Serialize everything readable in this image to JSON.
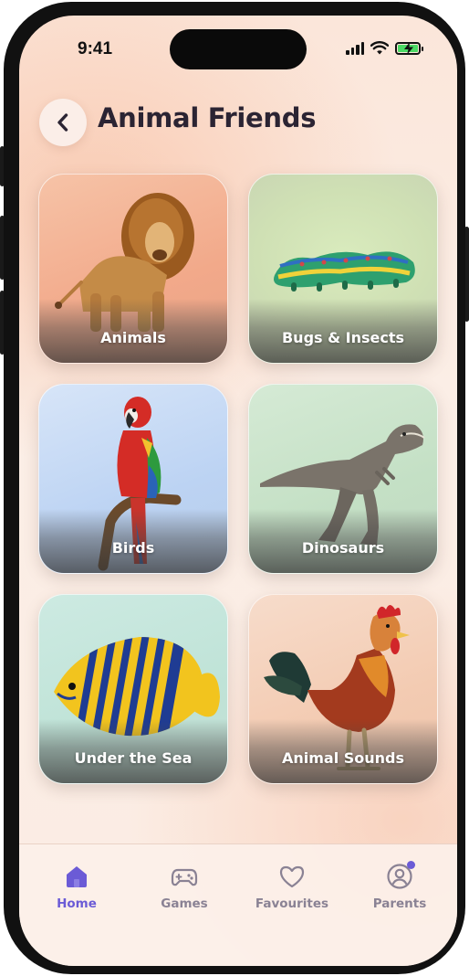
{
  "status_bar": {
    "time": "9:41"
  },
  "header": {
    "title": "Animal Friends",
    "back_icon": "chevron-left-icon"
  },
  "categories": [
    {
      "label": "Animals",
      "image": "lion",
      "bg": "#f3b08f"
    },
    {
      "label": "Bugs & Insects",
      "image": "caterpillar",
      "bg": "#cfe3b6"
    },
    {
      "label": "Birds",
      "image": "macaw",
      "bg": "#c8dcf5"
    },
    {
      "label": "Dinosaurs",
      "image": "t-rex",
      "bg": "#cfe5cf"
    },
    {
      "label": "Under the Sea",
      "image": "angelfish",
      "bg": "#c6e6dc"
    },
    {
      "label": "Animal Sounds",
      "image": "rooster",
      "bg": "#f4d2bd"
    }
  ],
  "bottom_nav": {
    "items": [
      {
        "label": "Home",
        "icon": "home-icon",
        "active": true
      },
      {
        "label": "Games",
        "icon": "gamepad-icon",
        "active": false
      },
      {
        "label": "Favourites",
        "icon": "heart-icon",
        "active": false
      },
      {
        "label": "Parents",
        "icon": "profile-icon",
        "active": false,
        "badge": true
      }
    ],
    "active_color": "#6b5bd6",
    "inactive_color": "#8a8294"
  }
}
